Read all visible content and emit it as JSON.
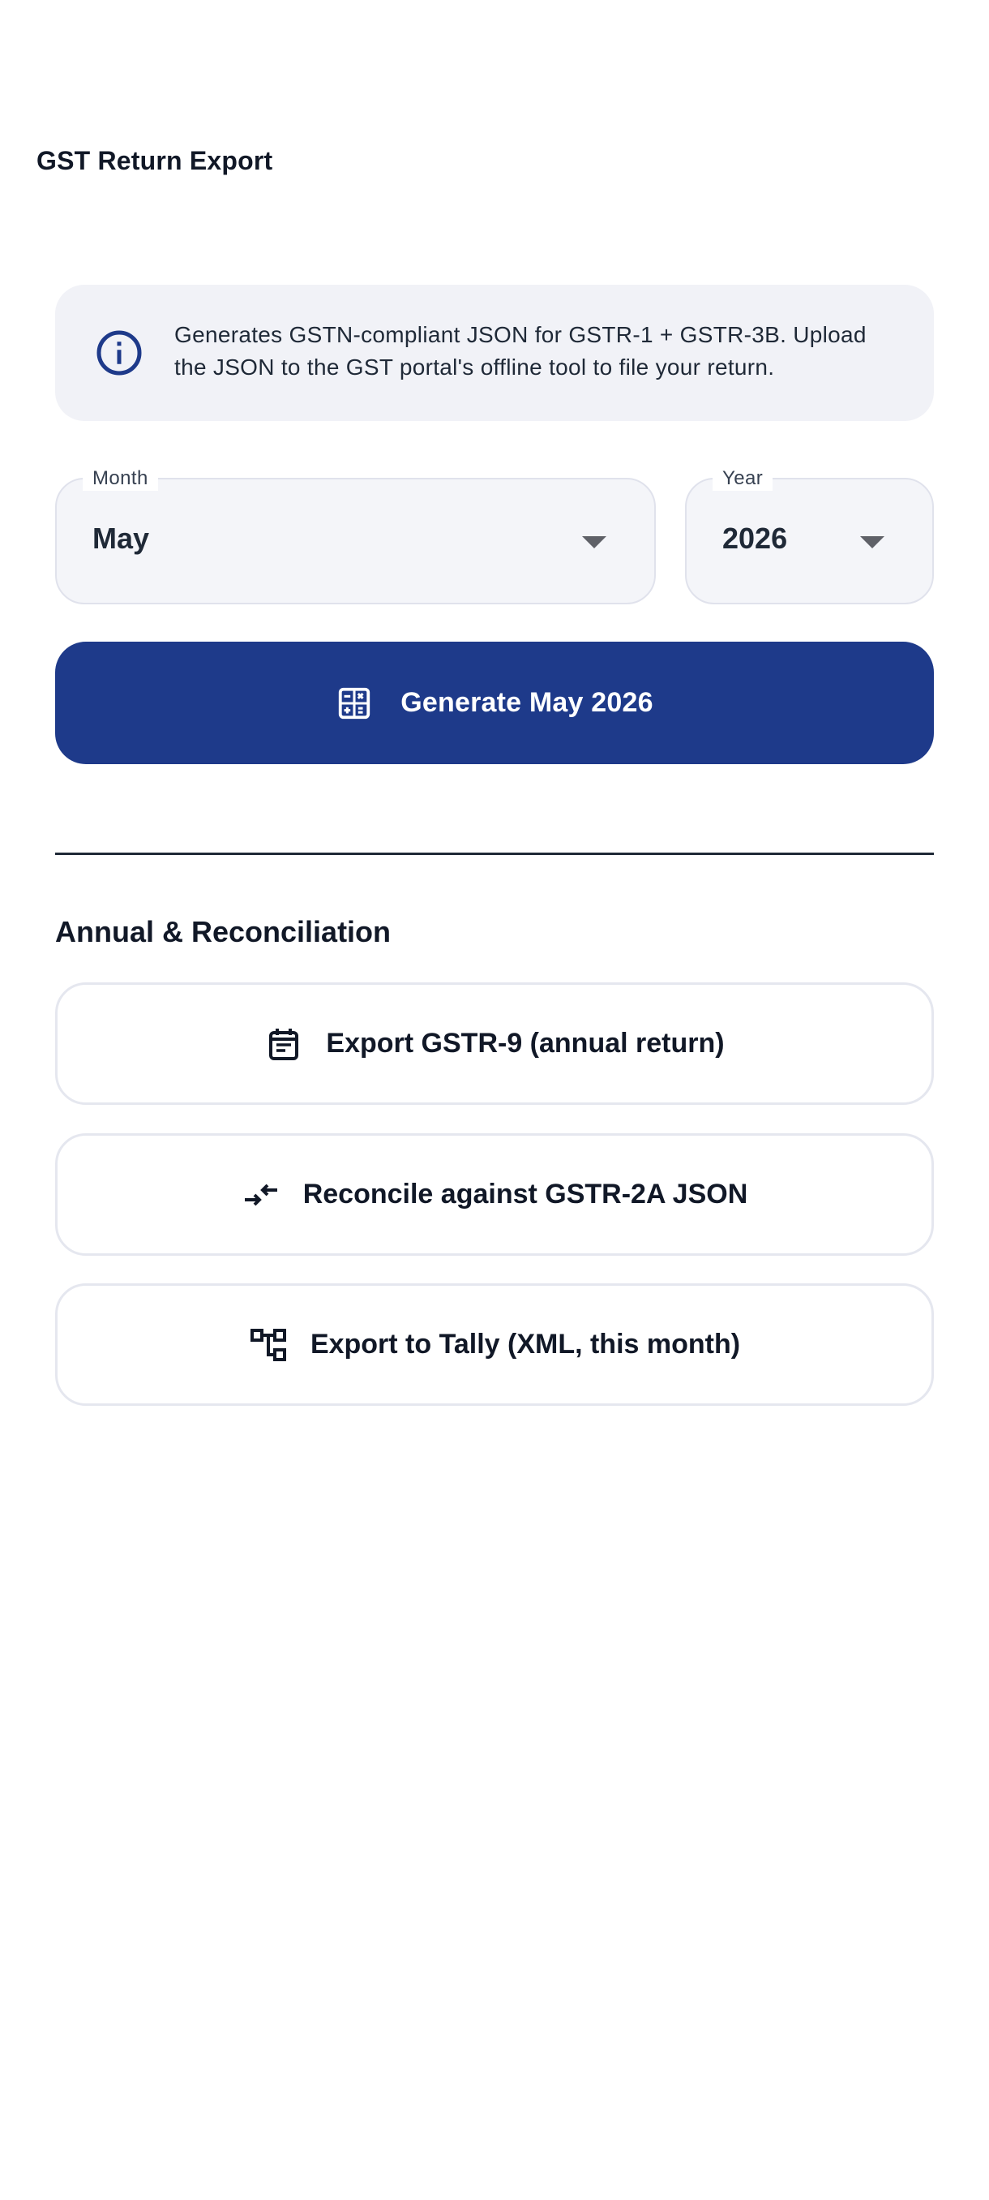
{
  "header": {
    "title": "GST Return Export"
  },
  "info": {
    "icon": "info-icon",
    "text": "Generates GSTN-compliant JSON for GSTR-1 + GSTR-3B. Upload the JSON to the GST portal's offline tool to file your return."
  },
  "filters": {
    "month": {
      "label": "Month",
      "value": "May"
    },
    "year": {
      "label": "Year",
      "value": "2026"
    }
  },
  "primary_action": {
    "icon": "calculator-icon",
    "label": "Generate May 2026"
  },
  "section": {
    "heading": "Annual & Reconciliation",
    "actions": [
      {
        "icon": "calendar-icon",
        "label": "Export GSTR-9 (annual return)"
      },
      {
        "icon": "compare-arrows-icon",
        "label": "Reconcile against GSTR-2A JSON"
      },
      {
        "icon": "account-tree-icon",
        "label": "Export to Tally (XML, this month)"
      }
    ]
  },
  "colors": {
    "primary": "#1e3a8a",
    "info_background": "#f1f2f7",
    "field_background": "#f4f5f9",
    "text": "#111827"
  }
}
